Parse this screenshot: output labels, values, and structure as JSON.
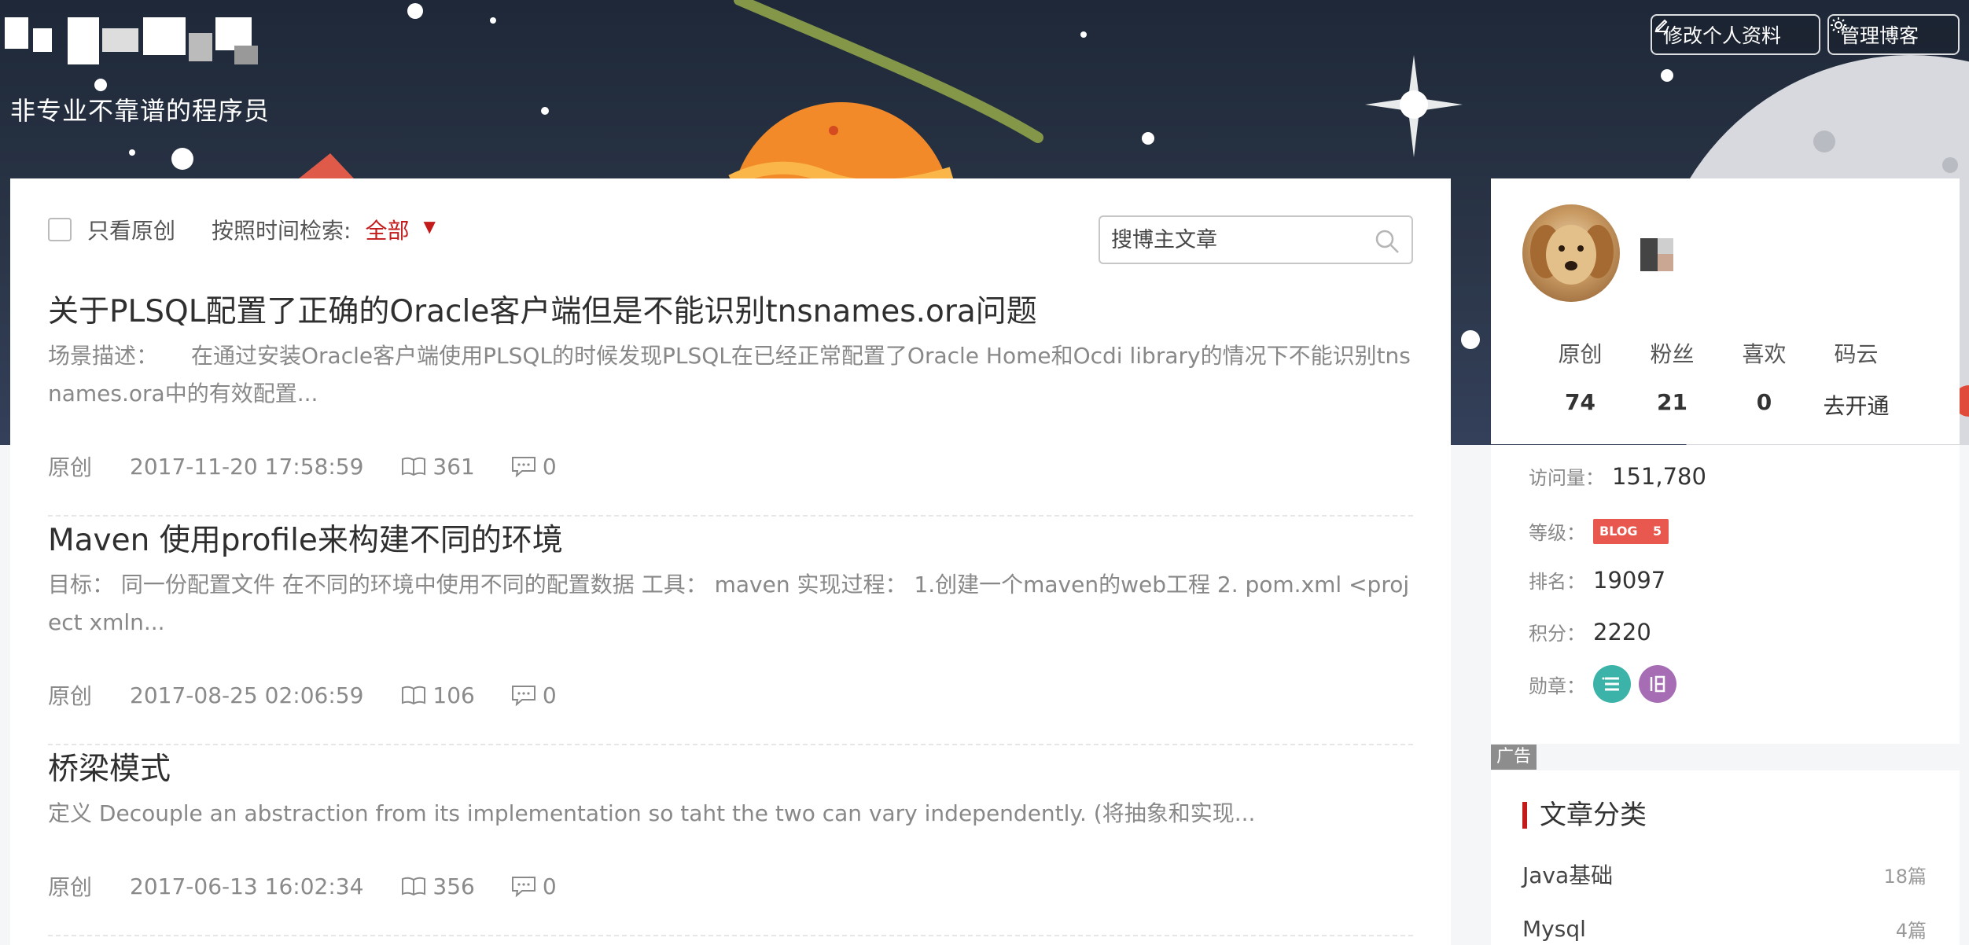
{
  "header": {
    "subtitle": "非专业不靠谱的程序员",
    "edit_profile_label": "修改个人资料",
    "manage_blog_label": "管理博客"
  },
  "filter": {
    "original_only_label": "只看原创",
    "time_filter_label": "按照时间检索:",
    "time_filter_value": "全部"
  },
  "search": {
    "placeholder": "搜博主文章"
  },
  "articles": [
    {
      "title": "关于PLSQL配置了正确的Oracle客户端但是不能识别tnsnames.ora问题",
      "description": "场景描述：　　在通过安装Oracle客户端使用PLSQL的时候发现PLSQL在已经正常配置了Oracle Home和Ocdi library的情况下不能识别tnsnames.ora中的有效配置...",
      "type": "原创",
      "date": "2017-11-20 17:58:59",
      "views": "361",
      "comments": "0"
    },
    {
      "title": "Maven 使用profile来构建不同的环境",
      "description": "目标： 同一份配置文件 在不同的环境中使用不同的配置数据 工具： maven 实现过程： 1.创建一个maven的web工程 2. pom.xml <project xmln...",
      "type": "原创",
      "date": "2017-08-25 02:06:59",
      "views": "106",
      "comments": "0"
    },
    {
      "title": "桥梁模式",
      "description": "定义 Decouple an abstraction from its implementation so taht the two can vary independently. (将抽象和实现...",
      "type": "原创",
      "date": "2017-06-13 16:02:34",
      "views": "356",
      "comments": "0"
    }
  ],
  "profile": {
    "stats": [
      {
        "label": "原创",
        "value": "74"
      },
      {
        "label": "粉丝",
        "value": "21"
      },
      {
        "label": "喜欢",
        "value": "0"
      },
      {
        "label": "码云",
        "value": "去开通"
      }
    ],
    "visits_label": "访问量：",
    "visits_value": "151,780",
    "level_label": "等级：",
    "level_badge_text": "BLOG",
    "level_badge_num": "5",
    "rank_label": "排名：",
    "rank_value": "19097",
    "points_label": "积分：",
    "points_value": "2220",
    "medals_label": "勋章：",
    "medal_colors": [
      "#3bb3a9",
      "#a66db5"
    ]
  },
  "ad_label": "广告",
  "categories": {
    "title": "文章分类",
    "items": [
      {
        "name": "Java基础",
        "count": "18篇"
      },
      {
        "name": "Mysql",
        "count": "4篇"
      }
    ]
  },
  "colors": {
    "accent_red": "#c31a1a",
    "banner_dark": "#1e2838"
  }
}
